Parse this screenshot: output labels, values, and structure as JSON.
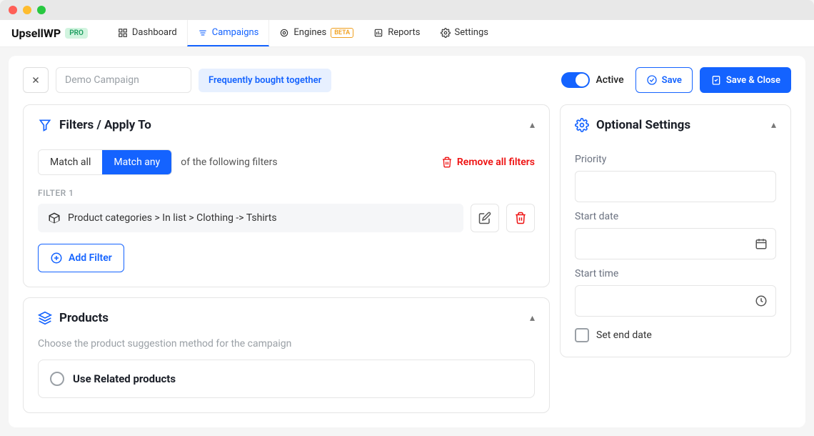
{
  "brand": {
    "name": "UpsellWP",
    "badge": "PRO"
  },
  "nav": {
    "dashboard": "Dashboard",
    "campaigns": "Campaigns",
    "engines": "Engines",
    "engines_badge": "BETA",
    "reports": "Reports",
    "settings": "Settings"
  },
  "header": {
    "campaign_name": "Demo Campaign",
    "tag": "Frequently bought together",
    "active_label": "Active",
    "save": "Save",
    "save_close": "Save & Close"
  },
  "filters": {
    "title": "Filters / Apply To",
    "match_all": "Match all",
    "match_any": "Match any",
    "match_suffix": "of the following filters",
    "remove_all": "Remove all filters",
    "filter_label": "FILTER 1",
    "filter_text": "Product categories > In list > Clothing -> Tshirts",
    "add_filter": "Add Filter"
  },
  "products": {
    "title": "Products",
    "hint": "Choose the product suggestion method for the campaign",
    "option1": "Use Related products"
  },
  "optional": {
    "title": "Optional Settings",
    "priority": "Priority",
    "start_date": "Start date",
    "start_time": "Start time",
    "set_end_date": "Set end date"
  }
}
